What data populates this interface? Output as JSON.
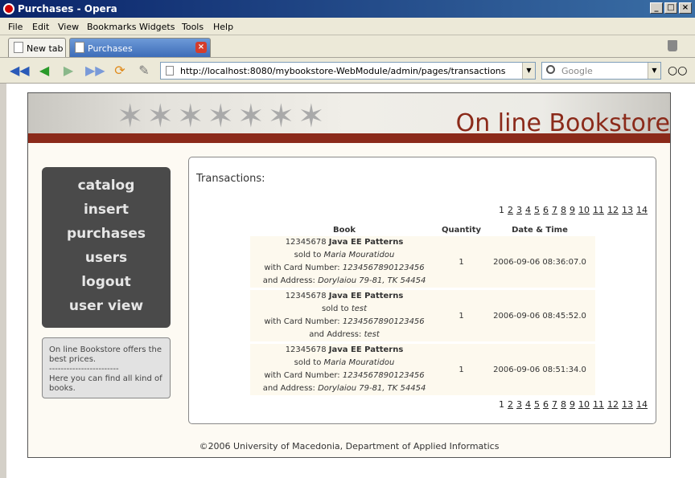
{
  "window": {
    "title": "Purchases - Opera"
  },
  "menu": [
    "File",
    "Edit",
    "View",
    "Bookmarks",
    "Widgets",
    "Tools",
    "Help"
  ],
  "tabs": [
    {
      "label": "New tab"
    },
    {
      "label": "Purchases"
    }
  ],
  "address": {
    "url": "http://localhost:8080/mybookstore-WebModule/admin/pages/transactions"
  },
  "search": {
    "placeholder": "Google"
  },
  "site": {
    "title": "On line Bookstore"
  },
  "nav": [
    {
      "label": "catalog"
    },
    {
      "label": "insert"
    },
    {
      "label": "purchases"
    },
    {
      "label": "users"
    },
    {
      "label": "logout"
    },
    {
      "label": "user view"
    }
  ],
  "info": {
    "line1": "On line Bookstore offers the best prices.",
    "divider": "------------------------",
    "line2": "Here you can find all kind of books."
  },
  "content": {
    "title": "Transactions:"
  },
  "pager": [
    "1",
    "2",
    "3",
    "4",
    "5",
    "6",
    "7",
    "8",
    "9",
    "10",
    "11",
    "12",
    "13",
    "14"
  ],
  "table": {
    "headers": {
      "book": "Book",
      "quantity": "Quantity",
      "datetime": "Date & Time"
    },
    "rows": [
      {
        "isbn": "12345678",
        "title": "Java EE Patterns",
        "sold_to_label": "sold to",
        "buyer": "Maria Mouratidou",
        "card_label": "with Card Number:",
        "card": "1234567890123456",
        "address_label": "and Address:",
        "address": "Dorylaiou 79-81, TK 54454",
        "quantity": "1",
        "datetime": "2006-09-06 08:36:07.0"
      },
      {
        "isbn": "12345678",
        "title": "Java EE Patterns",
        "sold_to_label": "sold to",
        "buyer": "test",
        "card_label": "with Card Number:",
        "card": "1234567890123456",
        "address_label": "and Address:",
        "address": "test",
        "quantity": "1",
        "datetime": "2006-09-06 08:45:52.0"
      },
      {
        "isbn": "12345678",
        "title": "Java EE Patterns",
        "sold_to_label": "sold to",
        "buyer": "Maria Mouratidou",
        "card_label": "with Card Number:",
        "card": "1234567890123456",
        "address_label": "and Address:",
        "address": "Dorylaiou 79-81, TK 54454",
        "quantity": "1",
        "datetime": "2006-09-06 08:51:34.0"
      }
    ]
  },
  "footer": "©2006 University of Macedonia, Department of Applied Informatics"
}
